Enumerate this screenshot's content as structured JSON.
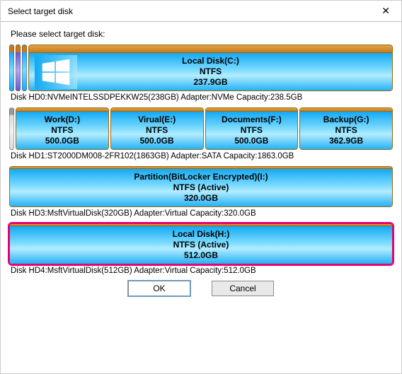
{
  "window": {
    "title": "Select target disk",
    "close_glyph": "✕"
  },
  "prompt": "Please select target disk:",
  "disks": [
    {
      "caption": "Disk HD0:NVMeINTELSSDPEKKW25(238GB)  Adapter:NVMe  Capacity:238.5GB",
      "row_class": "h-lg",
      "lead_strips": [
        "blue",
        "purple",
        "blue"
      ],
      "partitions": [
        {
          "name": "Local Disk(C:)",
          "fs": "NTFS",
          "size": "237.9GB",
          "winlogo": true,
          "selected": false
        }
      ]
    },
    {
      "caption": "Disk HD1:ST2000DM008-2FR102(1863GB)  Adapter:SATA  Capacity:1863.0GB",
      "row_class": "h-md",
      "lead_strips": [
        "gray"
      ],
      "partitions": [
        {
          "name": "Work(D:)",
          "fs": "NTFS",
          "size": "500.0GB",
          "selected": false
        },
        {
          "name": "Virual(E:)",
          "fs": "NTFS",
          "size": "500.0GB",
          "selected": false
        },
        {
          "name": "Documents(F:)",
          "fs": "NTFS",
          "size": "500.0GB",
          "selected": false
        },
        {
          "name": "Backup(G:)",
          "fs": "NTFS",
          "size": "362.9GB",
          "selected": false
        }
      ]
    },
    {
      "caption": "Disk HD3:MsftVirtualDisk(320GB)  Adapter:Virtual  Capacity:320.0GB",
      "row_class": "h-sm",
      "lead_strips": [],
      "partitions": [
        {
          "name": "Partition(BitLocker Encrypted)(I:)",
          "fs": "NTFS (Active)",
          "size": "320.0GB",
          "selected": false
        }
      ]
    },
    {
      "caption": "Disk HD4:MsftVirtualDisk(512GB)  Adapter:Virtual  Capacity:512.0GB",
      "row_class": "h-sel",
      "lead_strips": [],
      "partitions": [
        {
          "name": "Local Disk(H:)",
          "fs": "NTFS (Active)",
          "size": "512.0GB",
          "selected": true
        }
      ]
    }
  ],
  "buttons": {
    "ok": "OK",
    "cancel": "Cancel"
  }
}
